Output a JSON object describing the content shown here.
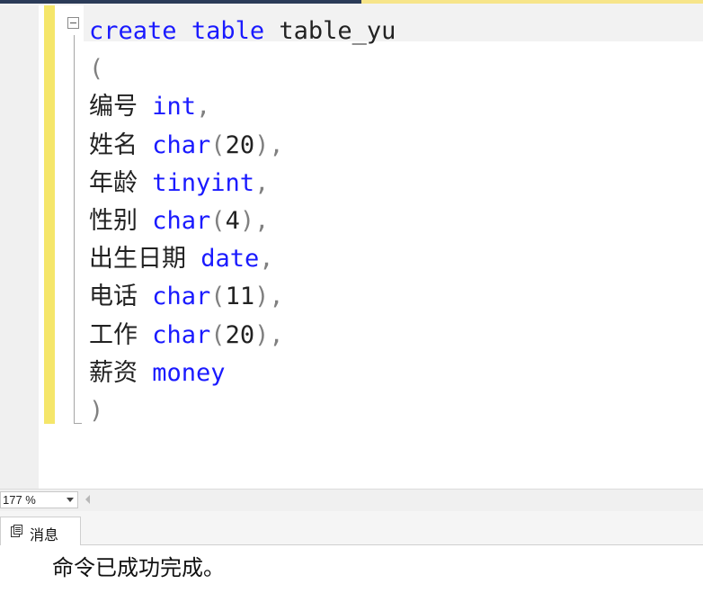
{
  "editor": {
    "lines": [
      {
        "segments": [
          {
            "text": "create",
            "cls": "kw"
          },
          {
            "text": " ",
            "cls": "plain"
          },
          {
            "text": "table",
            "cls": "kw"
          },
          {
            "text": " table_yu",
            "cls": "plain"
          }
        ]
      },
      {
        "segments": [
          {
            "text": "(",
            "cls": "punct"
          }
        ]
      },
      {
        "segments": [
          {
            "text": "编号",
            "cls": "cjk"
          },
          {
            "text": " ",
            "cls": "plain"
          },
          {
            "text": "int",
            "cls": "kw"
          },
          {
            "text": ",",
            "cls": "punct"
          }
        ]
      },
      {
        "segments": [
          {
            "text": "姓名",
            "cls": "cjk"
          },
          {
            "text": " ",
            "cls": "plain"
          },
          {
            "text": "char",
            "cls": "kw"
          },
          {
            "text": "(",
            "cls": "punct"
          },
          {
            "text": "20",
            "cls": "plain"
          },
          {
            "text": "),",
            "cls": "punct"
          }
        ]
      },
      {
        "segments": [
          {
            "text": "年龄",
            "cls": "cjk"
          },
          {
            "text": " ",
            "cls": "plain"
          },
          {
            "text": "tinyint",
            "cls": "kw"
          },
          {
            "text": ",",
            "cls": "punct"
          }
        ]
      },
      {
        "segments": [
          {
            "text": "性别",
            "cls": "cjk"
          },
          {
            "text": " ",
            "cls": "plain"
          },
          {
            "text": "char",
            "cls": "kw"
          },
          {
            "text": "(",
            "cls": "punct"
          },
          {
            "text": "4",
            "cls": "plain"
          },
          {
            "text": "),",
            "cls": "punct"
          }
        ]
      },
      {
        "segments": [
          {
            "text": "出生日期",
            "cls": "cjk"
          },
          {
            "text": " ",
            "cls": "plain"
          },
          {
            "text": "date",
            "cls": "kw"
          },
          {
            "text": ",",
            "cls": "punct"
          }
        ]
      },
      {
        "segments": [
          {
            "text": "电话",
            "cls": "cjk"
          },
          {
            "text": " ",
            "cls": "plain"
          },
          {
            "text": "char",
            "cls": "kw"
          },
          {
            "text": "(",
            "cls": "punct"
          },
          {
            "text": "11",
            "cls": "plain"
          },
          {
            "text": "),",
            "cls": "punct"
          }
        ]
      },
      {
        "segments": [
          {
            "text": "工作",
            "cls": "cjk"
          },
          {
            "text": " ",
            "cls": "plain"
          },
          {
            "text": "char",
            "cls": "kw"
          },
          {
            "text": "(",
            "cls": "punct"
          },
          {
            "text": "20",
            "cls": "plain"
          },
          {
            "text": "),",
            "cls": "punct"
          }
        ]
      },
      {
        "segments": [
          {
            "text": "薪资",
            "cls": "cjk"
          },
          {
            "text": " ",
            "cls": "plain"
          },
          {
            "text": "money",
            "cls": "kw"
          }
        ]
      },
      {
        "segments": [
          {
            "text": ")",
            "cls": "punct"
          }
        ]
      }
    ]
  },
  "statusbar": {
    "zoom_value": "177 %"
  },
  "results_panel": {
    "tabs": [
      {
        "label": "消息",
        "icon": "messages-icon"
      }
    ],
    "message": "命令已成功完成。"
  },
  "colors": {
    "keyword": "#1a1aff",
    "change_bar": "#f5e66a",
    "gutter": "#f0f0f0"
  }
}
